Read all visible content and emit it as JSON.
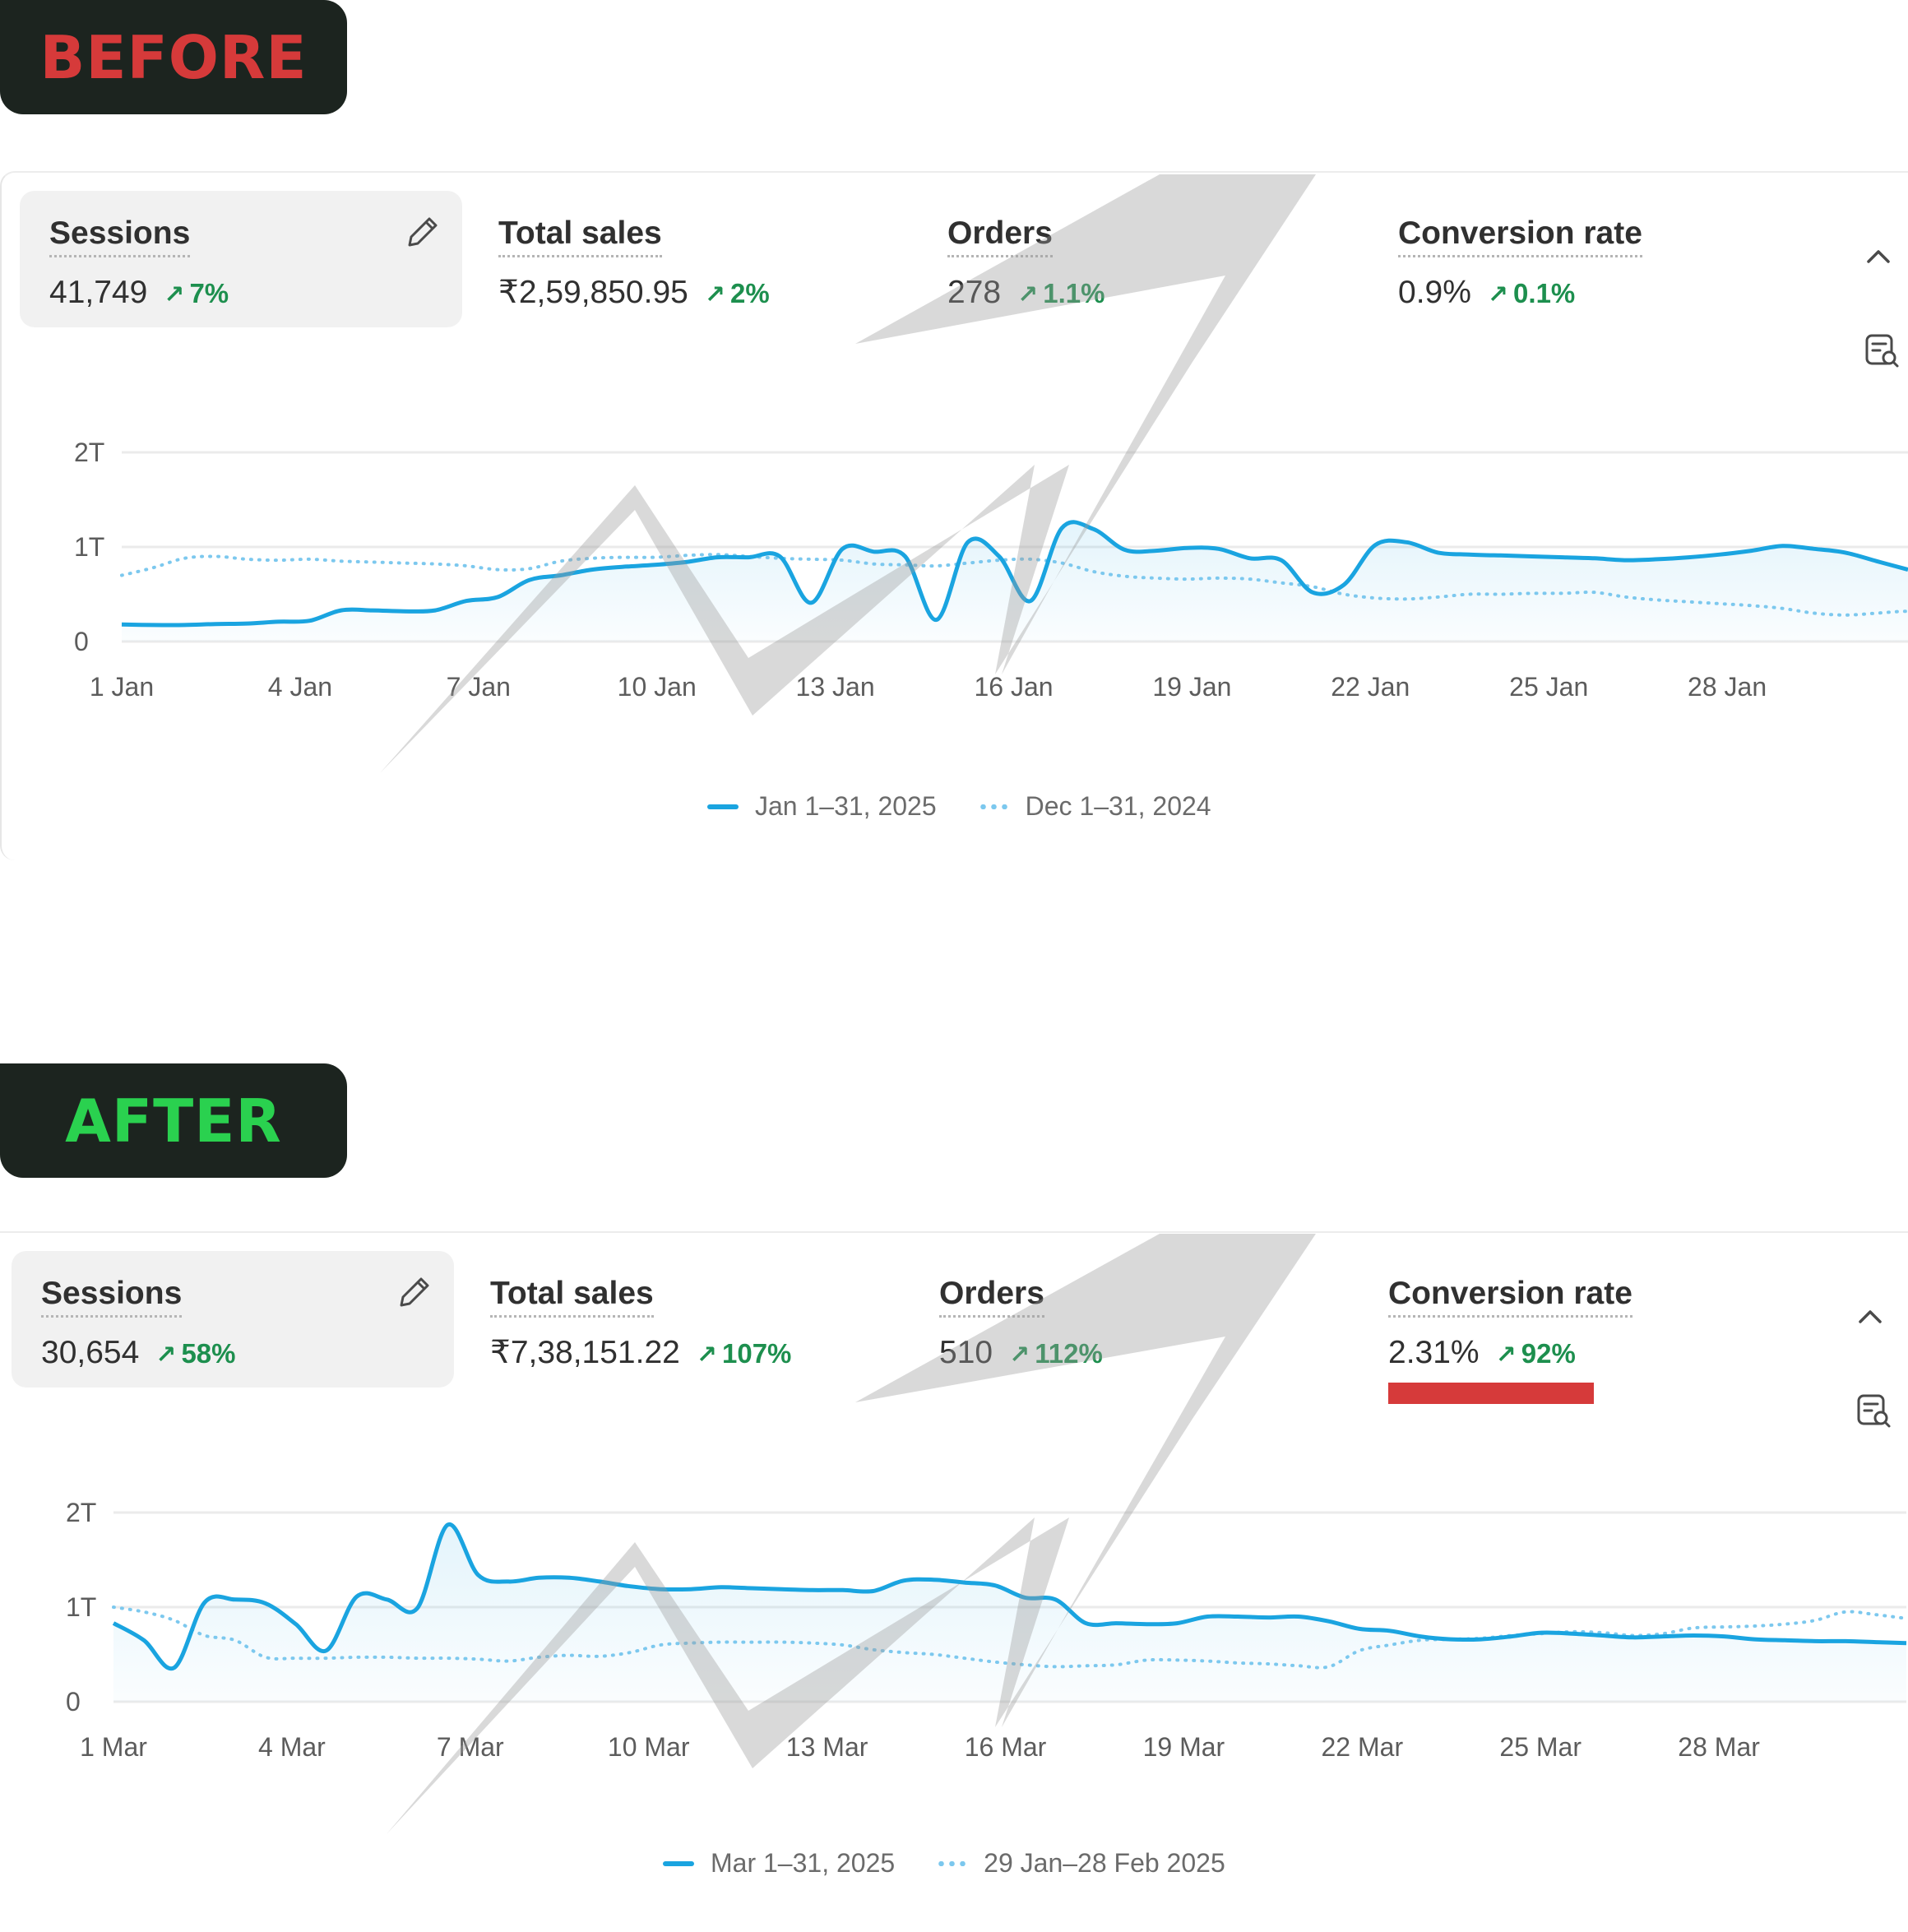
{
  "labels": {
    "before": "BEFORE",
    "after": "AFTER"
  },
  "colors": {
    "before_tag": "#d63a3a",
    "after_tag": "#2ad14f",
    "tag_bg": "#1c241f",
    "series_current": "#1aa4e0",
    "series_previous": "#7cc8ee",
    "delta_positive": "#1d8f4e",
    "highlight_bar": "#d63a3a"
  },
  "icons": [
    "pencil-icon",
    "chevron-up-icon",
    "data-search-icon",
    "arrow-up-right-icon"
  ],
  "before": {
    "metrics": [
      {
        "label": "Sessions",
        "value": "41,749",
        "delta": "7%"
      },
      {
        "label": "Total sales",
        "value": "₹2,59,850.95",
        "delta": "2%"
      },
      {
        "label": "Orders",
        "value": "278",
        "delta": "1.1%"
      },
      {
        "label": "Conversion rate",
        "value": "0.9%",
        "delta": "0.1%"
      }
    ],
    "legend": {
      "current": "Jan 1–31, 2025",
      "previous": "Dec 1–31, 2024"
    }
  },
  "after": {
    "metrics": [
      {
        "label": "Sessions",
        "value": "30,654",
        "delta": "58%"
      },
      {
        "label": "Total sales",
        "value": "₹7,38,151.22",
        "delta": "107%"
      },
      {
        "label": "Orders",
        "value": "510",
        "delta": "112%"
      },
      {
        "label": "Conversion rate",
        "value": "2.31%",
        "delta": "92%"
      }
    ],
    "legend": {
      "current": "Mar 1–31, 2025",
      "previous": "29 Jan–28 Feb 2025"
    }
  },
  "chart_data": [
    {
      "type": "line",
      "y_ticks": [
        "0",
        "1T",
        "2T"
      ],
      "ylim": [
        0,
        2000
      ],
      "x_ticks": [
        "1 Jan",
        "4 Jan",
        "7 Jan",
        "10 Jan",
        "13 Jan",
        "16 Jan",
        "19 Jan",
        "22 Jan",
        "25 Jan",
        "28 Jan"
      ],
      "grid": true,
      "legend_position": "bottom-center",
      "series": [
        {
          "name": "Jan 1–31, 2025",
          "style": "solid",
          "values": [
            180,
            175,
            175,
            185,
            190,
            210,
            220,
            330,
            330,
            320,
            330,
            430,
            470,
            650,
            700,
            760,
            790,
            810,
            840,
            890,
            890,
            900,
            410,
            980,
            950,
            900,
            230,
            1050,
            900,
            430,
            1200,
            1190,
            970,
            960,
            990,
            980,
            880,
            860,
            520,
            600,
            1020,
            1050,
            940,
            920,
            910,
            900,
            890,
            880,
            860,
            870,
            890,
            920,
            960,
            1010,
            980,
            940,
            850,
            760
          ]
        },
        {
          "name": "Dec 1–31, 2024",
          "style": "dotted",
          "values": [
            700,
            780,
            880,
            900,
            870,
            860,
            870,
            850,
            840,
            830,
            820,
            800,
            760,
            770,
            850,
            880,
            890,
            890,
            910,
            920,
            900,
            880,
            870,
            860,
            820,
            810,
            800,
            830,
            860,
            870,
            830,
            740,
            690,
            670,
            660,
            670,
            660,
            620,
            580,
            500,
            460,
            450,
            470,
            500,
            500,
            510,
            510,
            520,
            470,
            440,
            420,
            400,
            380,
            350,
            300,
            280,
            300,
            320,
            300,
            290
          ]
        }
      ]
    },
    {
      "type": "line",
      "y_ticks": [
        "0",
        "1T",
        "2T"
      ],
      "ylim": [
        0,
        2000
      ],
      "x_ticks": [
        "1 Mar",
        "4 Mar",
        "7 Mar",
        "10 Mar",
        "13 Mar",
        "16 Mar",
        "19 Mar",
        "22 Mar",
        "25 Mar",
        "28 Mar"
      ],
      "grid": true,
      "legend_position": "bottom-center",
      "series": [
        {
          "name": "Mar 1–31, 2025",
          "style": "solid",
          "values": [
            830,
            650,
            360,
            1050,
            1080,
            1040,
            820,
            540,
            1110,
            1080,
            990,
            1870,
            1340,
            1270,
            1310,
            1310,
            1270,
            1220,
            1190,
            1190,
            1210,
            1200,
            1190,
            1180,
            1180,
            1170,
            1280,
            1290,
            1260,
            1230,
            1100,
            1080,
            830,
            830,
            820,
            830,
            900,
            900,
            890,
            900,
            850,
            770,
            750,
            690,
            660,
            660,
            690,
            730,
            720,
            700,
            680,
            690,
            700,
            690,
            660,
            650,
            640,
            640,
            630,
            620
          ]
        },
        {
          "name": "29 Jan–28 Feb 2025",
          "style": "dotted",
          "values": [
            1000,
            950,
            860,
            700,
            650,
            470,
            460,
            460,
            470,
            470,
            460,
            460,
            450,
            430,
            470,
            490,
            480,
            520,
            600,
            620,
            630,
            630,
            630,
            620,
            600,
            550,
            520,
            500,
            460,
            420,
            390,
            370,
            380,
            390,
            440,
            440,
            430,
            410,
            400,
            380,
            370,
            540,
            600,
            650,
            660,
            670,
            700,
            720,
            740,
            730,
            700,
            720,
            780,
            790,
            800,
            820,
            860,
            950,
            920,
            880
          ]
        }
      ]
    }
  ]
}
